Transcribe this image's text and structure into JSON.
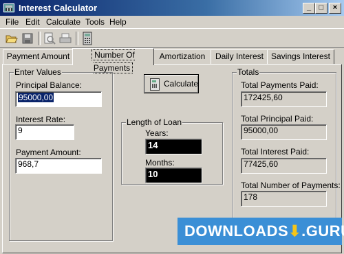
{
  "window": {
    "title": "Interest Calculator"
  },
  "caption_buttons": {
    "minimize": "_",
    "maximize": "□",
    "close": "×"
  },
  "menu": [
    "File",
    "Edit",
    "Calculate",
    "Tools",
    "Help"
  ],
  "toolbar": [
    "open-folder-icon",
    "save-disk-icon",
    "print-preview-icon",
    "print-icon",
    "calculator-icon"
  ],
  "tabs": [
    {
      "label": "Payment Amount",
      "active": false
    },
    {
      "label": "Number Of Payments",
      "active": true
    },
    {
      "label": "Amortization",
      "active": false
    },
    {
      "label": "Daily Interest",
      "active": false
    },
    {
      "label": "Savings Interest",
      "active": false
    }
  ],
  "enter_values": {
    "title": "Enter Values",
    "principal_label": "Principal Balance:",
    "principal_value": "95000,00",
    "rate_label": "Interest Rate:",
    "rate_value": "9",
    "payment_label": "Payment Amount:",
    "payment_value": "968,7"
  },
  "calculate_button": "Calculate",
  "length_of_loan": {
    "title": "Length of Loan",
    "years_label": "Years:",
    "years_value": "14",
    "months_label": "Months:",
    "months_value": "10"
  },
  "totals": {
    "title": "Totals",
    "payments_label": "Total Payments Paid:",
    "payments_value": "172425,60",
    "principal_label": "Total Principal Paid:",
    "principal_value": "95000,00",
    "interest_label": "Total Interest Paid:",
    "interest_value": "77425,60",
    "count_label": "Total Number of Payments:",
    "count_value": "178"
  },
  "watermark": {
    "left": "DOWNLOADS",
    "arrow": "⬇",
    "right": ".GURU"
  },
  "colors": {
    "titlebar": "#0a246a",
    "face": "#d4d0c8",
    "selection": "#0a246a",
    "watermark": "#3b8fd6"
  }
}
